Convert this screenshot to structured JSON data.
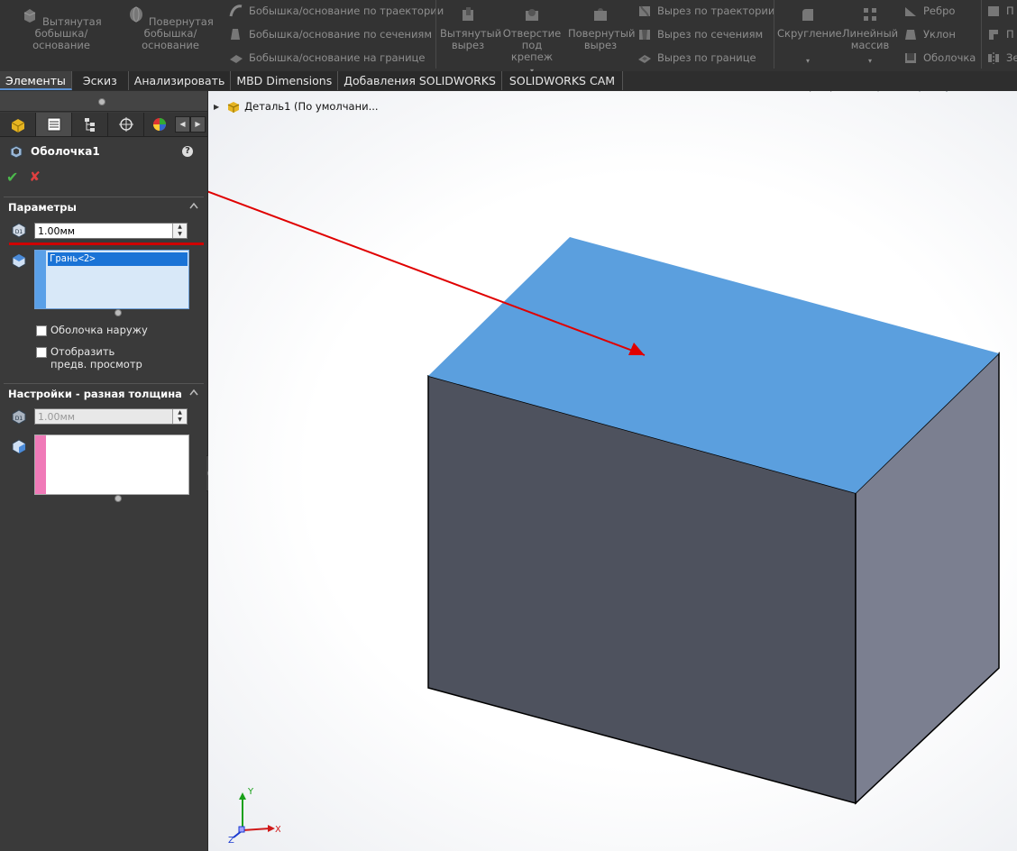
{
  "ribbon": {
    "extruded_boss": "Вытянутая бобышка/основание",
    "revolved_boss": "Повернутая бобышка/основание",
    "swept_boss": "Бобышка/основание по траектории",
    "lofted_boss": "Бобышка/основание по сечениям",
    "boundary_boss": "Бобышка/основание на границе",
    "extruded_cut": "Вытянутый вырез",
    "hole_wizard": "Отверстие под крепеж",
    "revolved_cut": "Повернутый вырез",
    "swept_cut": "Вырез по траектории",
    "lofted_cut": "Вырез по сечениям",
    "boundary_cut": "Вырез по границе",
    "fillet": "Скругление",
    "linear_pattern": "Линейный массив",
    "rib": "Ребро",
    "draft": "Уклон",
    "shell": "Оболочка",
    "right_1": "П",
    "right_2": "П",
    "right_3": "Зе"
  },
  "tabs": [
    "Элементы",
    "Эскиз",
    "Анализировать",
    "MBD Dimensions",
    "Добавления SOLIDWORKS",
    "SOLIDWORKS CAM"
  ],
  "property_manager": {
    "title": "Оболочка1",
    "help": "?",
    "ok": "✔",
    "cancel": "✘",
    "parameters": {
      "header": "Параметры",
      "thickness": "1.00мм",
      "faces": [
        "Грань<2>"
      ],
      "shell_outward": "Оболочка наружу",
      "show_preview": "Отобразить предв. просмотр"
    },
    "multi_thickness": {
      "header": "Настройки - разная толщина",
      "thickness": "1.00мм"
    }
  },
  "tree": {
    "root": "Деталь1  (По умолчани..."
  },
  "triad": {
    "x": "X",
    "y": "Y",
    "z": "Z"
  },
  "colors": {
    "ribbon_bg": "#333333",
    "panel_bg": "#3a3a3a",
    "top_face": "#5b9fde",
    "front_face": "#4e525e",
    "side_face": "#7b7f90",
    "annotation": "#e00000"
  }
}
